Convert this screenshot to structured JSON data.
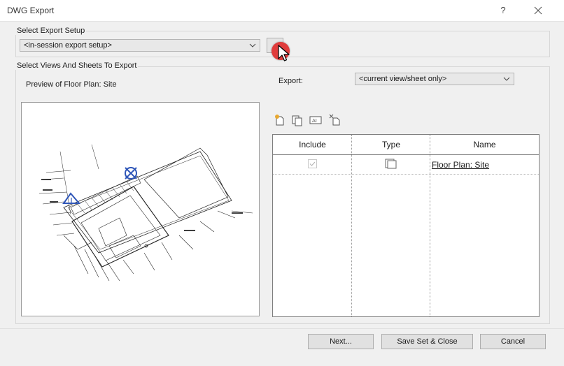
{
  "window": {
    "title": "DWG Export",
    "help": "?",
    "close_icon": "close-icon"
  },
  "export_setup": {
    "group_label": "Select Export Setup",
    "selected": "<in-session export setup>",
    "cursor_marker_color": "#e03c3c"
  },
  "views": {
    "group_label": "Select Views And Sheets To Export",
    "preview_label": "Preview of Floor Plan: Site",
    "export_label": "Export:",
    "export_selected": "<current view/sheet only>",
    "toolbar_icons": [
      "new-set-icon",
      "duplicate-set-icon",
      "rename-set-icon",
      "delete-set-icon"
    ],
    "table": {
      "columns": [
        "Include",
        "Type",
        "Name"
      ],
      "rows": [
        {
          "include": true,
          "type_icon": "sheet-icon",
          "name": "Floor Plan: Site"
        }
      ]
    }
  },
  "buttons": {
    "next": "Next...",
    "save_close": "Save Set & Close",
    "cancel": "Cancel"
  }
}
